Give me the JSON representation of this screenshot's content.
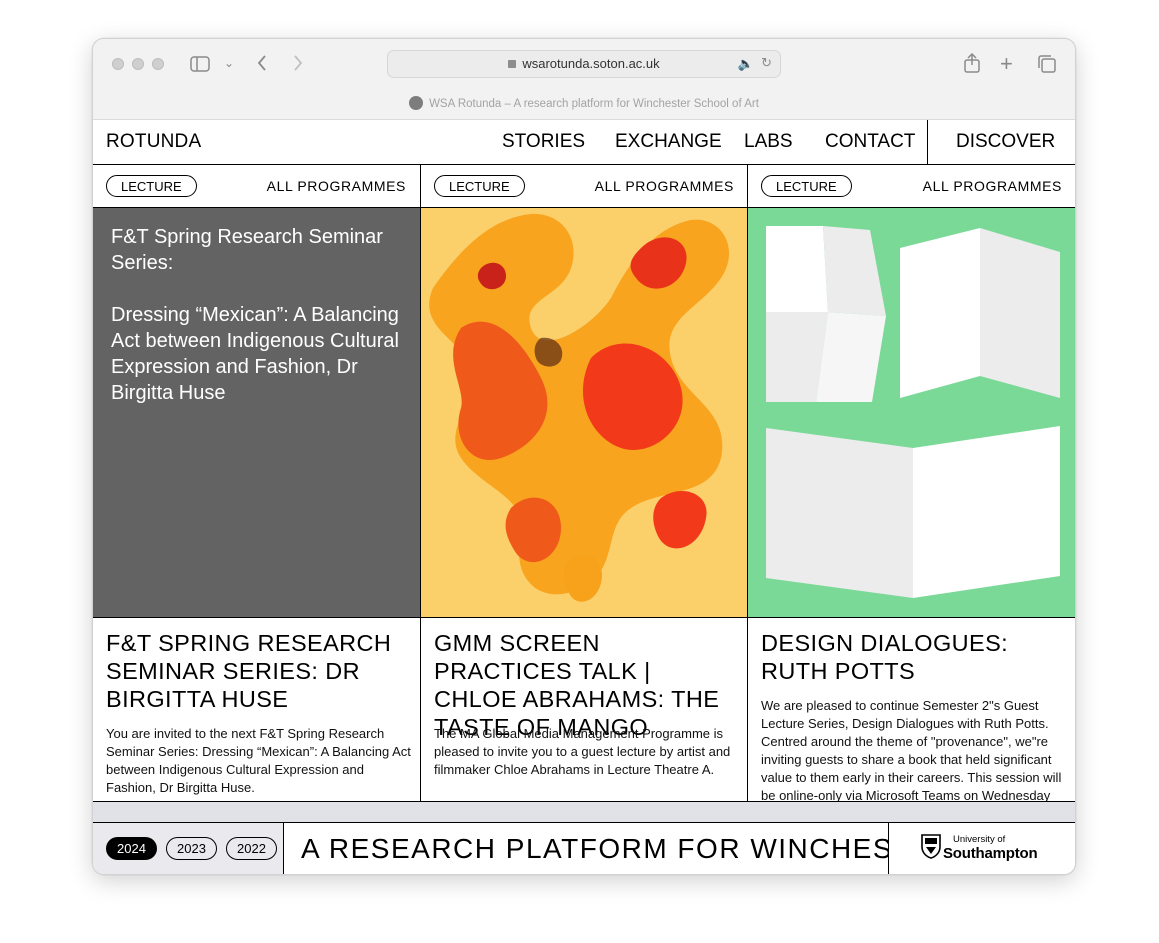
{
  "browser": {
    "url": "wsarotunda.soton.ac.uk",
    "tab_title": "WSA Rotunda – A research platform for Winchester School of Art",
    "colors": {
      "chrome_bg": "#f2f2f2",
      "speaker": "#3b82f6"
    }
  },
  "nav": {
    "brand": "ROTUNDA",
    "items": [
      {
        "label": "STORIES"
      },
      {
        "label": "EXCHANGE"
      },
      {
        "label": "LABS"
      },
      {
        "label": "CONTACT"
      }
    ],
    "discover": "DISCOVER"
  },
  "columns": [
    {
      "tag": "LECTURE",
      "all_programmes": "ALL PROGRAMMES",
      "poster_color": "#636363",
      "poster_heading": "F&T Spring Research Seminar Series:",
      "poster_subtitle": "Dressing “Mexican”: A Balancing Act between Indigenous Cultural Expression and Fashion, Dr Birgitta Huse",
      "title": "F&T SPRING RESEARCH SEMINAR SERIES: DR BIRGITTA HUSE",
      "description": "You are invited to the next F&T Spring Research Seminar Series: Dressing “Mexican”: A Balancing Act between Indigenous Cultural Expression and Fashion, Dr Birgitta Huse."
    },
    {
      "tag": "LECTURE",
      "all_programmes": "ALL PROGRAMMES",
      "poster_color": "#fbd06b",
      "title": "GMM SCREEN PRACTICES TALK | CHLOE ABRAHAMS: THE TASTE OF MANGO",
      "description": "The MA Global Media Management Programme is pleased to invite you to a guest lecture by artist and filmmaker Chloe Abrahams in Lecture Theatre A."
    },
    {
      "tag": "LECTURE",
      "all_programmes": "ALL PROGRAMMES",
      "poster_color": "#7ad996",
      "title": "DESIGN DIALOGUES: RUTH POTTS",
      "description": "We are pleased to continue Semester 2\"s Guest Lecture Series, Design Dialogues with Ruth Potts. Centred around the theme of \"provenance\", we\"re inviting guests to share a book that held significant value to them early in their careers. This session will be online-only via Microsoft Teams on Wednesday"
    }
  ],
  "footer": {
    "years": [
      {
        "label": "2024",
        "active": true
      },
      {
        "label": "2023",
        "active": false
      },
      {
        "label": "2022",
        "active": false
      }
    ],
    "marquee": "A RESEARCH PLATFORM FOR WINCHESTER",
    "university_of": "University of",
    "university_name": "Southampton"
  }
}
